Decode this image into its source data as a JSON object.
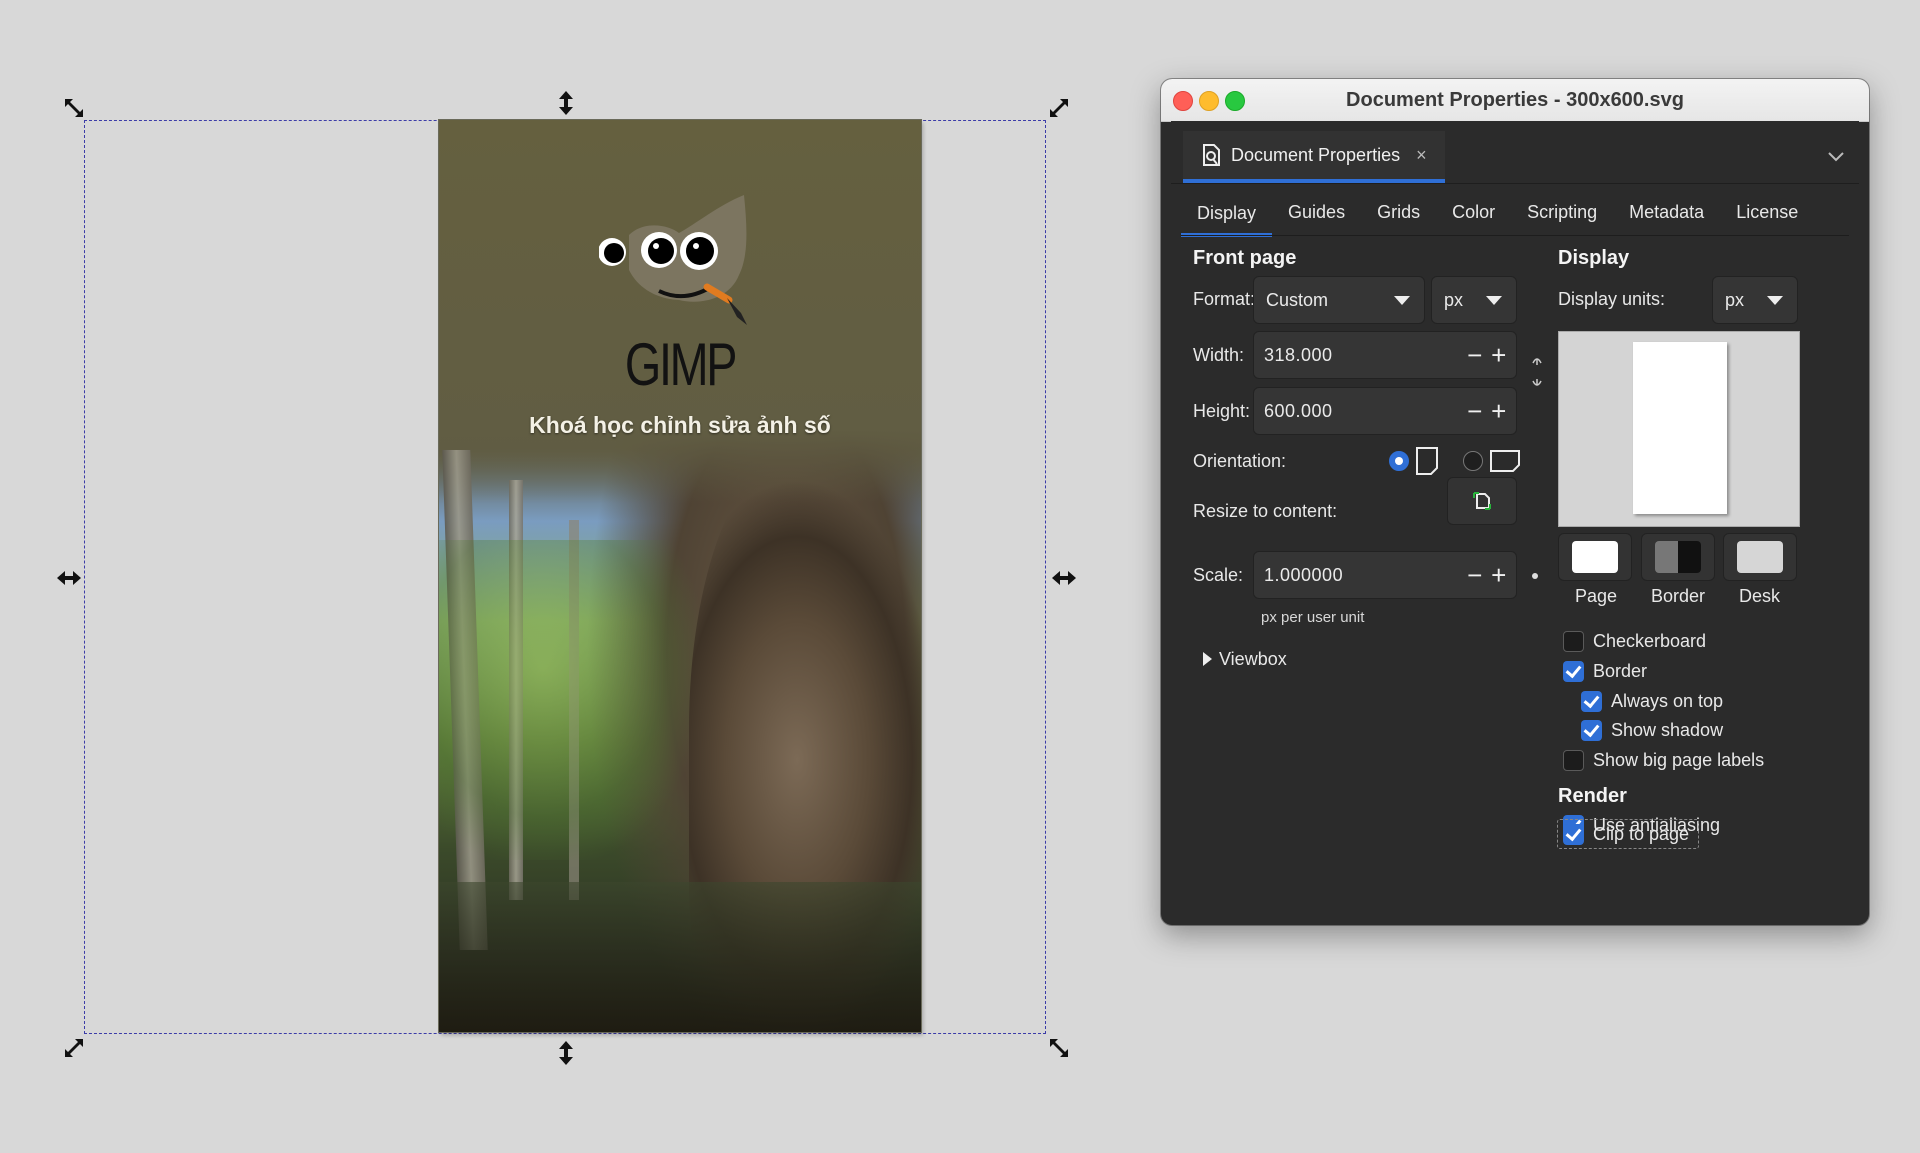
{
  "canvas": {
    "artwork_title": "GIMP",
    "artwork_subtitle": "Khoá học chỉnh sửa ảnh số"
  },
  "window": {
    "title": "Document Properties - 300x600.svg"
  },
  "doc_tab": {
    "label": "Document Properties",
    "close": "×"
  },
  "tabs": [
    "Display",
    "Guides",
    "Grids",
    "Color",
    "Scripting",
    "Metadata",
    "License"
  ],
  "front_page": {
    "heading": "Front page",
    "format_label": "Format:",
    "format_value": "Custom",
    "unit_value": "px",
    "width_label": "Width:",
    "width_value": "318.000",
    "height_label": "Height:",
    "height_value": "600.000",
    "orientation_label": "Orientation:",
    "resize_label": "Resize to content:",
    "scale_label": "Scale:",
    "scale_value": "1.000000",
    "scale_unit_note": "px per user unit",
    "viewbox_label": "Viewbox",
    "minus": "−",
    "plus": "+"
  },
  "display": {
    "heading": "Display",
    "units_label": "Display units:",
    "units_value": "px",
    "swatches": [
      "Page",
      "Border",
      "Desk"
    ],
    "checkboxes": {
      "checkboard": "Checkerboard",
      "border": "Border",
      "always_on_top": "Always on top",
      "show_shadow": "Show shadow",
      "big_labels": "Show big page labels"
    },
    "checked": {
      "checkboard": false,
      "border": true,
      "always_on_top": true,
      "show_shadow": true,
      "big_labels": false
    }
  },
  "render": {
    "heading": "Render",
    "antialias": "Use antialiasing",
    "clip": "Clip to page",
    "checked": {
      "antialias": true,
      "clip": true
    }
  },
  "colors": {
    "accent": "#2f6fd6",
    "canvas_bg": "#d8d8d8",
    "panel_bg": "#2b2b2b"
  }
}
